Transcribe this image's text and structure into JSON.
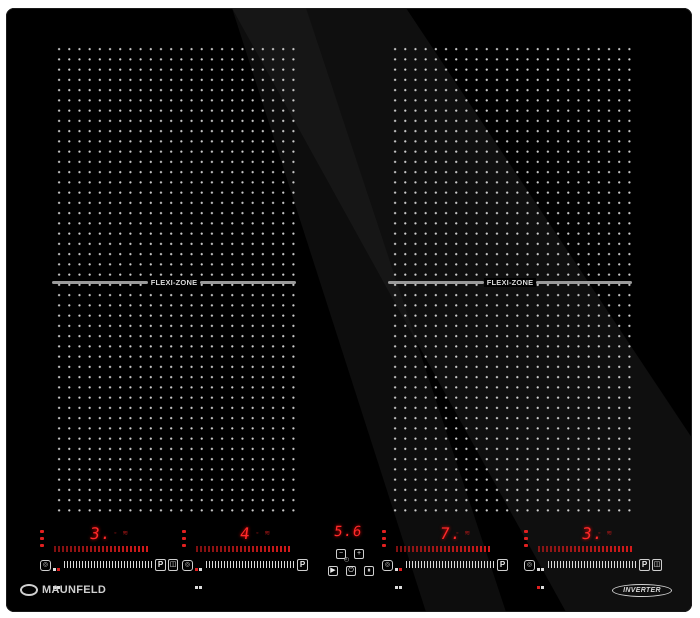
{
  "brand": {
    "name": "MAUNFELD",
    "badge": "INVERTER"
  },
  "zones": [
    {
      "side": "left",
      "flexi_label": "FLEXI-ZONE"
    },
    {
      "side": "right",
      "flexi_label": "FLEXI-ZONE"
    }
  ],
  "burners": [
    {
      "level": "3.",
      "lock": "P"
    },
    {
      "level": "4",
      "lock": "P"
    },
    {
      "level": "7.",
      "lock": "P"
    },
    {
      "level": "3.",
      "lock": "P"
    }
  ],
  "timer": {
    "display": "5.6",
    "minus": "−",
    "plus": "+",
    "play": "▶",
    "stop": "⏸"
  },
  "colors": {
    "glass": "#000000",
    "led_red": "#ff2a2a",
    "print_gray": "#cfcfcf"
  },
  "icons": {
    "pan": "pan-detection-icon",
    "lock": "child-lock-icon",
    "clock": "clock-icon"
  }
}
